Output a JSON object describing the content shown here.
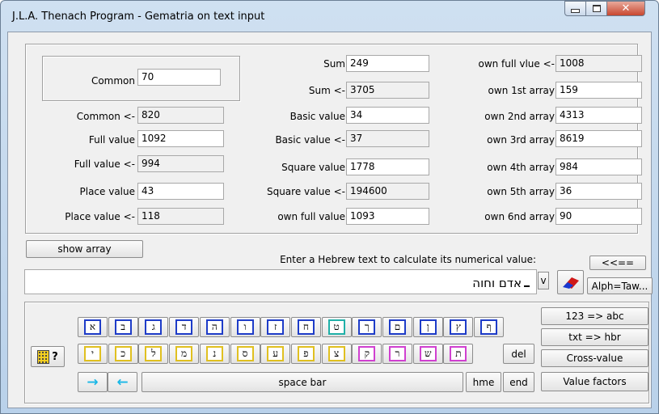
{
  "window": {
    "title": "J.L.A. Thenach Program - Gematria on text input"
  },
  "fields": {
    "common": {
      "label": "Common",
      "value": "70"
    },
    "common_rev": {
      "label": "Common <-",
      "value": "820"
    },
    "full_value": {
      "label": "Full value",
      "value": "1092"
    },
    "full_value_rev": {
      "label": "Full value <-",
      "value": "994"
    },
    "place_value": {
      "label": "Place value",
      "value": "43"
    },
    "place_value_rev": {
      "label": "Place value <-",
      "value": "118"
    },
    "sum": {
      "label": "Sum",
      "value": "249"
    },
    "sum_rev": {
      "label": "Sum <-",
      "value": "3705"
    },
    "basic_value": {
      "label": "Basic value",
      "value": "34"
    },
    "basic_value_rev": {
      "label": "Basic value <-",
      "value": "37"
    },
    "square_value": {
      "label": "Square value",
      "value": "1778"
    },
    "square_value_rev": {
      "label": "Square value <-",
      "value": "194600"
    },
    "own_full_value": {
      "label": "own full value",
      "value": "1093"
    },
    "own_full_vlue_rev": {
      "label": "own full vlue <-",
      "value": "1008"
    },
    "own_1st": {
      "label": "own 1st array",
      "value": "159"
    },
    "own_2nd": {
      "label": "own 2nd array",
      "value": "4313"
    },
    "own_3rd": {
      "label": "own 3rd array",
      "value": "8619"
    },
    "own_4th": {
      "label": "own 4th array",
      "value": "984"
    },
    "own_5th": {
      "label": "own 5th array",
      "value": "36"
    },
    "own_6nd": {
      "label": "own 6nd array",
      "value": "90"
    }
  },
  "controls": {
    "show_array": "show array",
    "prompt": "Enter a Hebrew text to calculate its numerical value:",
    "text_input": "אדם וחוה",
    "dropdown_v": "v",
    "back_button": "<<==",
    "alph_taw": "Alph=Taw..."
  },
  "keyboard": {
    "row1": [
      "א",
      "ב",
      "ג",
      "ד",
      "ה",
      "ו",
      "ז",
      "ח",
      "ט",
      "ך",
      "ם",
      "ן",
      "ץ",
      "ף"
    ],
    "row1_colors": [
      "#1e3cc8",
      "#1e3cc8",
      "#1e3cc8",
      "#1e3cc8",
      "#1e3cc8",
      "#1e3cc8",
      "#1e3cc8",
      "#1e3cc8",
      "#20b0a8",
      "#1e3cc8",
      "#1e3cc8",
      "#1e3cc8",
      "#1e3cc8",
      "#1e3cc8"
    ],
    "row2": [
      "י",
      "כ",
      "ל",
      "מ",
      "נ",
      "ס",
      "ע",
      "פ",
      "צ",
      "ק",
      "ר",
      "ש",
      "ת"
    ],
    "row2_colors": [
      "#e0c020",
      "#e0c020",
      "#e0c020",
      "#e0c020",
      "#e0c020",
      "#e0c020",
      "#e0c020",
      "#e0c020",
      "#e0c020",
      "#d040d0",
      "#d040d0",
      "#d040d0",
      "#d040d0"
    ],
    "del": "del",
    "space_bar": "space bar",
    "hme": "hme",
    "end": "end",
    "arrow_right": "→",
    "arrow_left": "←",
    "help": "?"
  },
  "side_buttons": [
    "123 => abc",
    "txt => hbr",
    "Cross-value",
    "Value factors"
  ],
  "icons": {
    "minimize": "minimize-icon",
    "maximize": "maximize-icon",
    "close": "close-icon",
    "eraser": "eraser-icon",
    "keyboard": "keyboard-icon"
  }
}
